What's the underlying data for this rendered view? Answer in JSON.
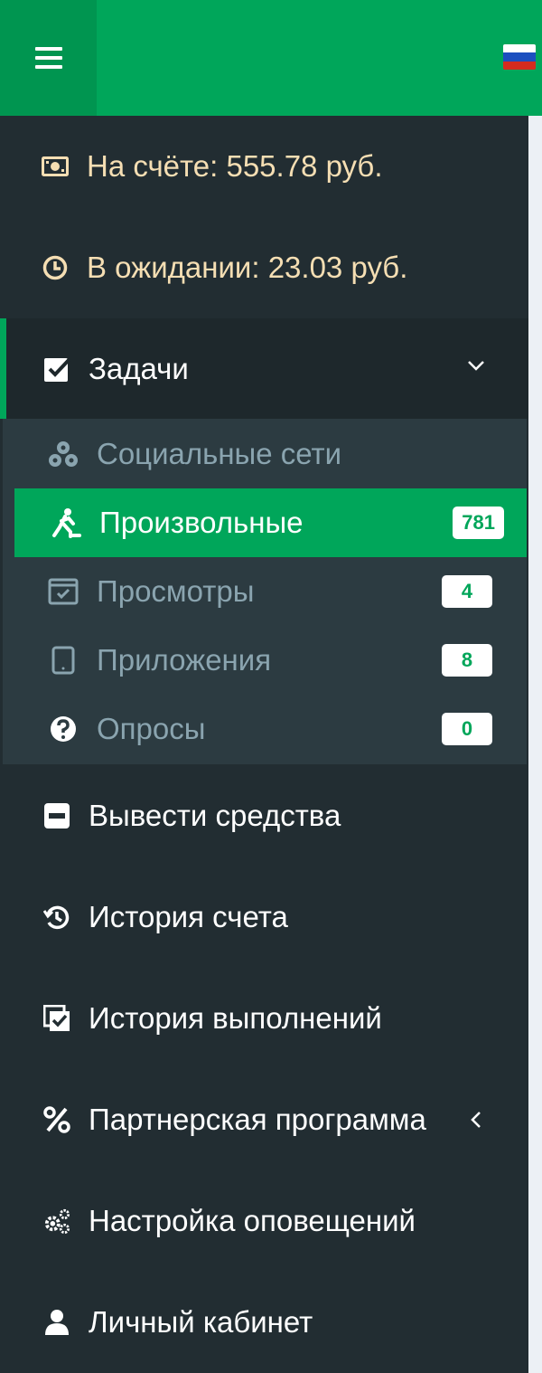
{
  "colors": {
    "brand": "#00a65a",
    "sidebar_bg": "#222d32",
    "submenu_bg": "#2c3b41",
    "accent_text": "#f5deb3"
  },
  "header": {
    "menu_icon": "hamburger-icon",
    "language_icon": "flag-ru-icon"
  },
  "balance": {
    "account": {
      "label": "На счёте: 555.78 руб.",
      "icon": "money-icon"
    },
    "pending": {
      "label": "В ожидании: 23.03 руб.",
      "icon": "clock-icon"
    }
  },
  "menu": {
    "tasks": {
      "label": "Задачи",
      "icon": "checkbox-icon",
      "expanded": true
    },
    "sub": [
      {
        "label": "Социальные сети",
        "icon": "social-icon",
        "badge": ""
      },
      {
        "label": "Произвольные",
        "icon": "custom-task-icon",
        "badge": "781",
        "active": true
      },
      {
        "label": "Просмотры",
        "icon": "browser-check-icon",
        "badge": "4"
      },
      {
        "label": "Приложения",
        "icon": "tablet-icon",
        "badge": "8"
      },
      {
        "label": "Опросы",
        "icon": "question-icon",
        "badge": "0"
      }
    ],
    "withdraw": {
      "label": "Вывести средства",
      "icon": "minus-square-icon"
    },
    "account_history": {
      "label": "История счета",
      "icon": "history-icon"
    },
    "completion_history": {
      "label": "История выполнений",
      "icon": "copy-check-icon"
    },
    "partner": {
      "label": "Партнерская программа",
      "icon": "percent-icon"
    },
    "notifications": {
      "label": "Настройка оповещений",
      "icon": "cogs-icon"
    },
    "cabinet": {
      "label": "Личный кабинет",
      "icon": "user-icon"
    }
  }
}
